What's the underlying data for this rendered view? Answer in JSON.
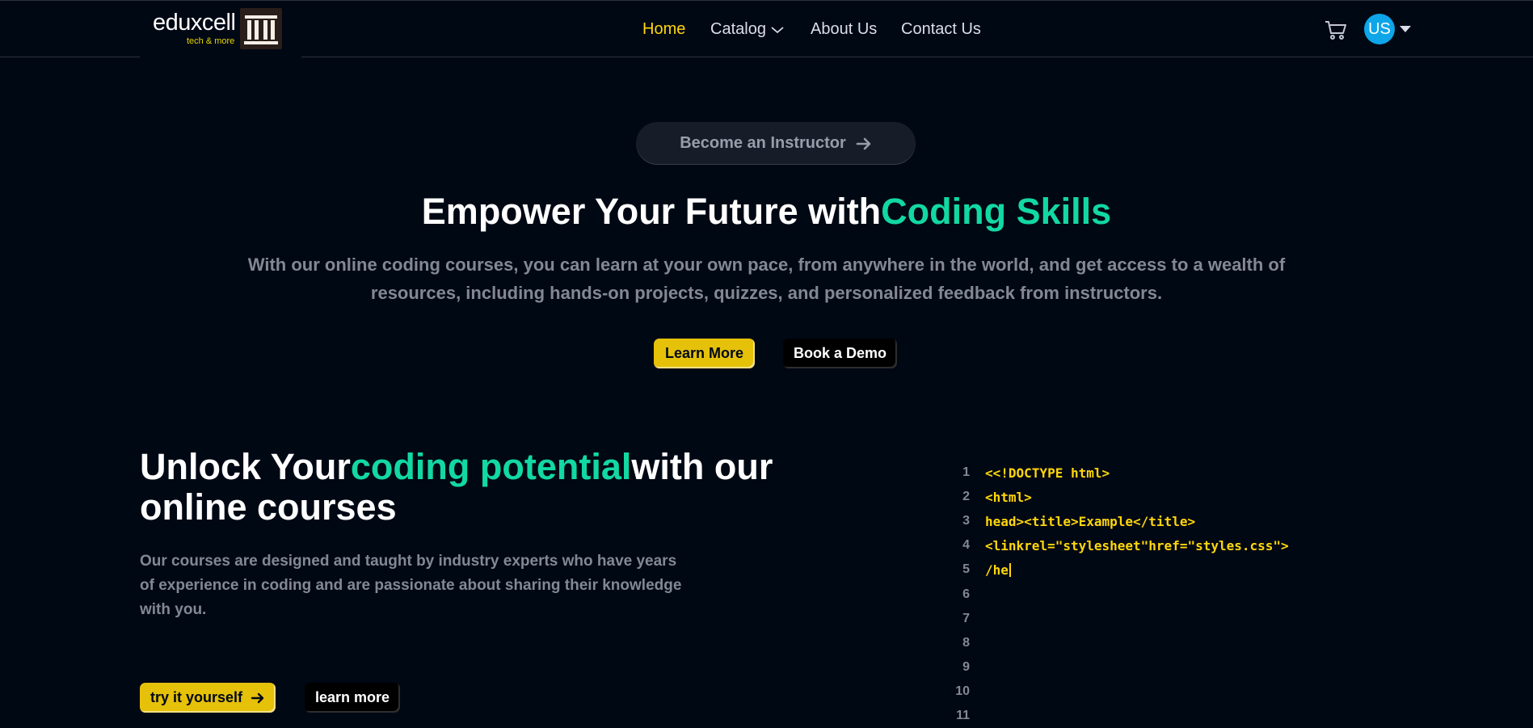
{
  "brand": {
    "name": "eduxcell",
    "tagline": "tech & more"
  },
  "nav": {
    "items": [
      {
        "label": "Home",
        "active": true
      },
      {
        "label": "Catalog"
      },
      {
        "label": "About Us"
      },
      {
        "label": "Contact Us"
      }
    ],
    "avatar_initials": "US",
    "icons": [
      "cart-icon",
      "chevron-down-icon",
      "caret-down-icon"
    ]
  },
  "hero": {
    "instructor_button": "Become an Instructor",
    "title_part1": "Empower Your Future with",
    "title_highlight": "Coding Skills",
    "subtitle": "With our online coding courses, you can learn at your own pace, from anywhere in the world, and get access to a wealth of resources, including hands-on projects, quizzes, and personalized feedback from instructors.",
    "learn_more": "Learn More",
    "book_demo": "Book a Demo"
  },
  "section": {
    "title_part1": "Unlock Your",
    "title_highlight": "coding potential",
    "title_part2": "with our online courses",
    "description": "Our courses are designed and taught by industry experts who have years of experience in coding and are passionate about sharing their knowledge with you.",
    "try_button": "try it yourself",
    "learn_button": "learn more"
  },
  "code_lines": [
    {
      "num": "1",
      "text": "<<!DOCTYPE html>"
    },
    {
      "num": "2",
      "text": "<html>"
    },
    {
      "num": "3",
      "text": "head><title>Example</title>"
    },
    {
      "num": "4",
      "text": "<linkrel=\"stylesheet\"href=\"styles.css\">"
    },
    {
      "num": "5",
      "text": "/he"
    },
    {
      "num": "6",
      "text": ""
    },
    {
      "num": "7",
      "text": ""
    },
    {
      "num": "8",
      "text": ""
    },
    {
      "num": "9",
      "text": ""
    },
    {
      "num": "10",
      "text": ""
    },
    {
      "num": "11",
      "text": ""
    }
  ],
  "colors": {
    "background": "#000814",
    "accent_yellow": "#ffd60a",
    "accent_green": "#12d8a1",
    "muted_text": "#838894"
  }
}
